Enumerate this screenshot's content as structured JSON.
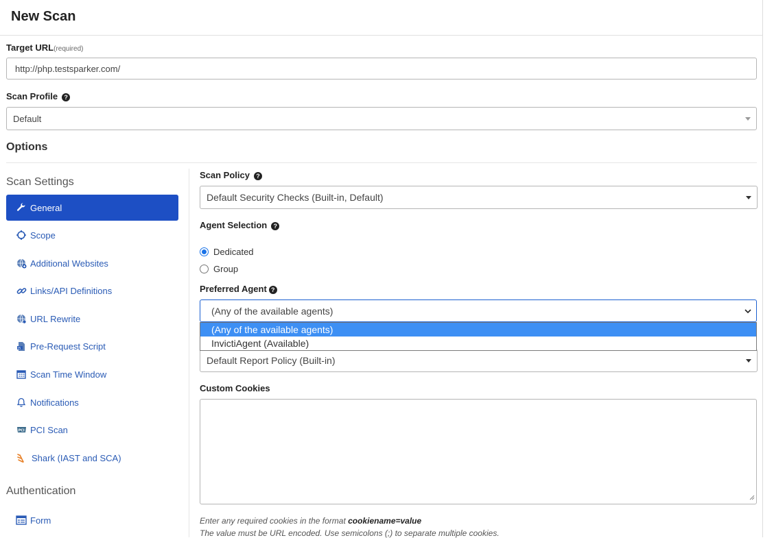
{
  "page": {
    "title": "New Scan"
  },
  "target_url": {
    "label": "Target URL",
    "required_note": "(required)",
    "value": "http://php.testsparker.com/"
  },
  "scan_profile": {
    "label": "Scan Profile",
    "value": "Default"
  },
  "options": {
    "title": "Options"
  },
  "sidebar": {
    "scan_settings_title": "Scan Settings",
    "items": [
      {
        "label": "General",
        "icon": "wrench-icon",
        "active": true
      },
      {
        "label": "Scope",
        "icon": "crosshair-icon"
      },
      {
        "label": "Additional Websites",
        "icon": "globe-plus-icon"
      },
      {
        "label": "Links/API Definitions",
        "icon": "link-icon"
      },
      {
        "label": "URL Rewrite",
        "icon": "globe-gear-icon"
      },
      {
        "label": "Pre-Request Script",
        "icon": "js-file-icon"
      },
      {
        "label": "Scan Time Window",
        "icon": "calendar-icon"
      },
      {
        "label": "Notifications",
        "icon": "bell-icon"
      },
      {
        "label": "PCI Scan",
        "icon": "pci-icon"
      },
      {
        "label": "Shark (IAST and SCA)",
        "icon": "shark-icon"
      }
    ],
    "authentication_title": "Authentication",
    "auth_items": [
      {
        "label": "Form",
        "icon": "form-icon"
      }
    ]
  },
  "scan_policy": {
    "label": "Scan Policy",
    "value": "Default Security Checks (Built-in, Default)"
  },
  "agent_selection": {
    "label": "Agent Selection",
    "options": [
      {
        "label": "Dedicated",
        "checked": true
      },
      {
        "label": "Group",
        "checked": false
      }
    ]
  },
  "preferred_agent": {
    "label": "Preferred Agent",
    "value": "(Any of the available agents)",
    "options": [
      {
        "label": "(Any of the available agents)",
        "selected": true
      },
      {
        "label": "InvictiAgent (Available)",
        "selected": false
      }
    ]
  },
  "report_policy": {
    "value": "Default Report Policy (Built-in)"
  },
  "custom_cookies": {
    "label": "Custom Cookies",
    "value": "",
    "hint_prefix": "Enter any required cookies in the format ",
    "hint_format": "cookiename=value",
    "hint_line2": "The value must be URL encoded. Use semicolons (;) to separate multiple cookies."
  },
  "colors": {
    "accent": "#1d4fc4",
    "link": "#2a5bb5",
    "dropdown_highlight": "#3d8ff4"
  }
}
